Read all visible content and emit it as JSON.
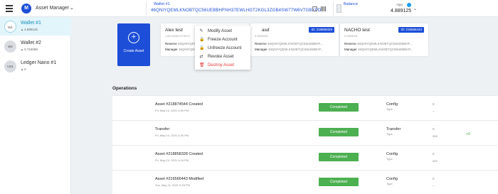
{
  "header": {
    "app_title": "Asset Manager",
    "app_chevron": "⌄",
    "wallet_label": "Wallet #1",
    "wallet_address": "46QNIYQEMLKNOBTQC56UEBBHFNH37EWLHGT2KGL3ZGB4SW77W6V7GBKPDY",
    "balance_label": "Balance",
    "balance_currency": "Algo",
    "balance_amount": "4.889125",
    "balance_chevron": "⌄"
  },
  "sidebar": {
    "accounts": [
      {
        "avatar": "W1",
        "name": "Wallet #1",
        "balance": "4.889125",
        "active": true
      },
      {
        "avatar": "W2",
        "name": "Wallet #2",
        "balance": "0.715099",
        "active": false
      },
      {
        "avatar": "LN1",
        "name": "Ledger Nano #1",
        "balance": "0",
        "active": false
      }
    ]
  },
  "create_asset": {
    "icon": "+",
    "label": "Create Asset"
  },
  "assets": [
    {
      "name": "Alex test",
      "sub": "1.64+4054+073072",
      "id": "",
      "reserve_label": "Reserve",
      "reserve_value": "46QNIYQEMLKNOBTQC56UEBBHF...",
      "manager_label": "Manager",
      "manager_value": "46QNIYQEMLKNOBTQC56UEBBHF..."
    },
    {
      "name": "asd",
      "sub": "0.0000001",
      "id": "ID: 218858328",
      "reserve_label": "Reserve",
      "reserve_value": "46QNIYQEMLKNOBTQC56UEBBHF...",
      "manager_label": "Manager",
      "manager_value": "46QNIYQEMLKNOBTQC56UEBBHF..."
    },
    {
      "name": "NACHO test",
      "sub": "0.0000001",
      "id": "ID: 216566443",
      "reserve_label": "Reserve",
      "reserve_value": "46QNIYQEMLKNOBTQC56UEBBHF...",
      "manager_label": "Manager",
      "manager_value": "46QNIYQEMLKNOBTQC56UEBBHF..."
    }
  ],
  "context_menu": {
    "items": [
      {
        "icon": "✎",
        "label": "Modify Asset"
      },
      {
        "icon": "🔒",
        "label": "Freeze Account"
      },
      {
        "icon": "🔓",
        "label": "Unfreeze Account"
      },
      {
        "icon": "⇄",
        "label": "Revoke Asset"
      },
      {
        "icon": "🗑",
        "label": "Destroy Asset"
      }
    ]
  },
  "operations": {
    "title": "Operations",
    "rows": [
      {
        "title": "Asset #218874544 Created",
        "date": "Fri, May 14, 2021 4:53 PM",
        "status": "Completed",
        "type": "Config",
        "type_label": "Type",
        "col_x": "0",
        "col_dash": "–",
        "amount": ""
      },
      {
        "title": "Transfer",
        "date": "Fri, May 14, 2021 4:30 PM",
        "status": "Completed",
        "type": "Transfer",
        "type_label": "Type",
        "col_x": "0",
        "col_dash": "xxx",
        "amount": "+0"
      },
      {
        "title": "Asset #218858328 Created",
        "date": "Fri, May 14, 2021 4:24 PM",
        "status": "Completed",
        "type": "Config",
        "type_label": "Type",
        "col_x": "0",
        "col_dash": "xxx",
        "amount": ""
      },
      {
        "title": "Asset #216566443 Modified",
        "date": "Tue, May 11, 2021 5:18 PM",
        "status": "Completed",
        "type": "Config",
        "type_label": "Type",
        "col_x": "0",
        "col_dash": "–",
        "amount": ""
      }
    ]
  }
}
